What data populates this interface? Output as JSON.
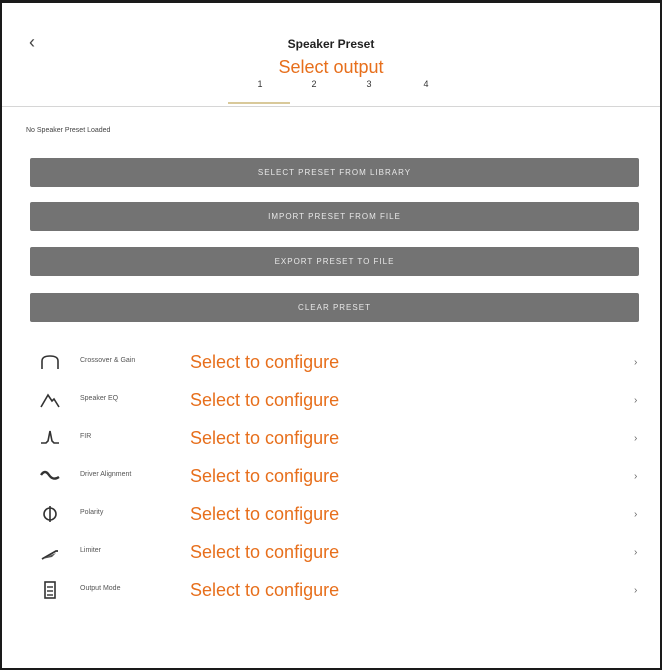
{
  "header": {
    "back_icon": "chevron-left-icon",
    "back_glyph": "‹",
    "title": "Speaker Preset",
    "subtitle": "Select output",
    "steps": [
      "1",
      "2",
      "3",
      "4"
    ],
    "active_step": "1"
  },
  "status": "No Speaker Preset Loaded",
  "buttons": [
    "SELECT PRESET FROM LIBRARY",
    "IMPORT PRESET FROM FILE",
    "EXPORT PRESET TO FILE",
    "CLEAR PRESET"
  ],
  "rows": [
    {
      "label": "Crossover & Gain",
      "hint": "Select to configure",
      "icon": "crossover-icon",
      "chevron": "›"
    },
    {
      "label": "Speaker EQ",
      "hint": "Select to configure",
      "icon": "speaker-eq-icon",
      "chevron": "›"
    },
    {
      "label": "FIR",
      "hint": "Select to configure",
      "icon": "fir-icon",
      "chevron": "›"
    },
    {
      "label": "Driver Alignment",
      "hint": "Select to configure",
      "icon": "driver-alignment-icon",
      "chevron": "›"
    },
    {
      "label": "Polarity",
      "hint": "Select to configure",
      "icon": "polarity-icon",
      "chevron": "›"
    },
    {
      "label": "Limiter",
      "hint": "Select to configure",
      "icon": "limiter-icon",
      "chevron": "›"
    },
    {
      "label": "Output Mode",
      "hint": "Select to configure",
      "icon": "output-mode-icon",
      "chevron": "›"
    }
  ],
  "colors": {
    "accent": "#e76f1c",
    "button_bg": "#737373",
    "step_underline": "#d9c99a"
  }
}
